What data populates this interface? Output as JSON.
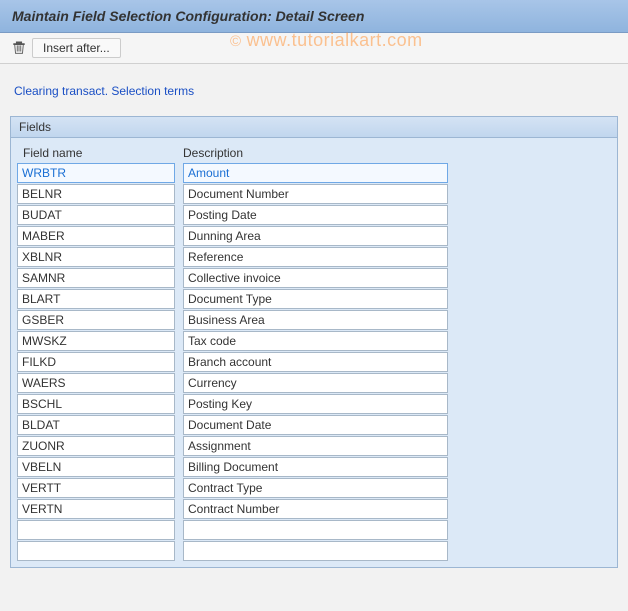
{
  "header": {
    "title": "Maintain Field Selection Configuration: Detail Screen"
  },
  "toolbar": {
    "insert_after_label": "Insert after..."
  },
  "link_row": {
    "label": "Clearing transact. Selection terms"
  },
  "panel": {
    "title": "Fields",
    "columns": {
      "field_name": "Field name",
      "description": "Description"
    },
    "rows": [
      {
        "name": "WRBTR",
        "desc": "Amount",
        "selected": true
      },
      {
        "name": "BELNR",
        "desc": "Document Number",
        "selected": false
      },
      {
        "name": "BUDAT",
        "desc": "Posting Date",
        "selected": false
      },
      {
        "name": "MABER",
        "desc": "Dunning Area",
        "selected": false
      },
      {
        "name": "XBLNR",
        "desc": "Reference",
        "selected": false
      },
      {
        "name": "SAMNR",
        "desc": "Collective invoice",
        "selected": false
      },
      {
        "name": "BLART",
        "desc": "Document Type",
        "selected": false
      },
      {
        "name": "GSBER",
        "desc": "Business Area",
        "selected": false
      },
      {
        "name": "MWSKZ",
        "desc": "Tax code",
        "selected": false
      },
      {
        "name": "FILKD",
        "desc": "Branch account",
        "selected": false
      },
      {
        "name": "WAERS",
        "desc": "Currency",
        "selected": false
      },
      {
        "name": "BSCHL",
        "desc": "Posting Key",
        "selected": false
      },
      {
        "name": "BLDAT",
        "desc": "Document Date",
        "selected": false
      },
      {
        "name": "ZUONR",
        "desc": "Assignment",
        "selected": false
      },
      {
        "name": "VBELN",
        "desc": "Billing Document",
        "selected": false
      },
      {
        "name": "VERTT",
        "desc": "Contract Type",
        "selected": false
      },
      {
        "name": "VERTN",
        "desc": "Contract Number",
        "selected": false
      },
      {
        "name": "",
        "desc": "",
        "selected": false
      },
      {
        "name": "",
        "desc": "",
        "selected": false
      }
    ]
  },
  "watermark": {
    "text": "www.tutorialkart.com",
    "copyright": "©"
  }
}
